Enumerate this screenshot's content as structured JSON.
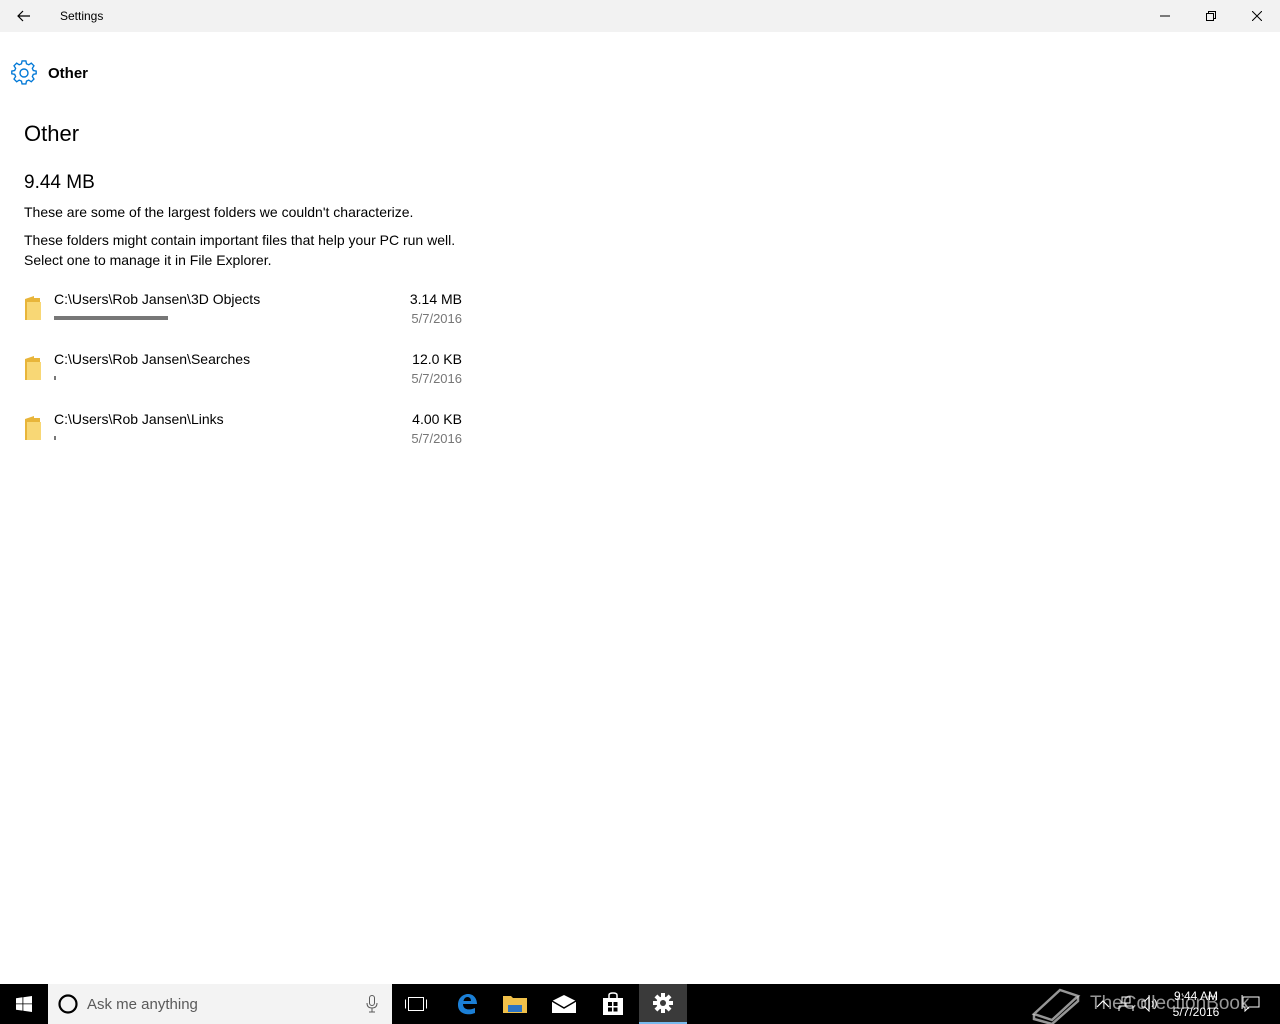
{
  "window": {
    "title": "Settings"
  },
  "header": {
    "icon": "gear-icon",
    "label": "Other"
  },
  "main": {
    "heading": "Other",
    "total": "9.44 MB",
    "description1": "These are some of the largest folders we couldn't characterize.",
    "description2": "These folders might contain important files that help your PC run well. Select one to manage it in File Explorer."
  },
  "folders": [
    {
      "path": "C:\\Users\\Rob Jansen\\3D Objects",
      "size": "3.14 MB",
      "date": "5/7/2016",
      "usage_fraction": 0.38
    },
    {
      "path": "C:\\Users\\Rob Jansen\\Searches",
      "size": "12.0 KB",
      "date": "5/7/2016",
      "usage_fraction": 0.005
    },
    {
      "path": "C:\\Users\\Rob Jansen\\Links",
      "size": "4.00 KB",
      "date": "5/7/2016",
      "usage_fraction": 0.005
    }
  ],
  "taskbar": {
    "search_placeholder": "Ask me anything",
    "apps": [
      "task-view-icon",
      "edge-icon",
      "file-explorer-icon",
      "mail-icon",
      "store-icon",
      "settings-icon"
    ],
    "active_app": "settings-icon",
    "time": "9:44 AM",
    "date": "5/7/2016",
    "watermark": "TheCollectionBook"
  },
  "colors": {
    "accent": "#0078d7",
    "titlebar": "#f2f2f2",
    "bar": "#777777",
    "folder": "#f5c842",
    "taskbar": "#000000"
  }
}
